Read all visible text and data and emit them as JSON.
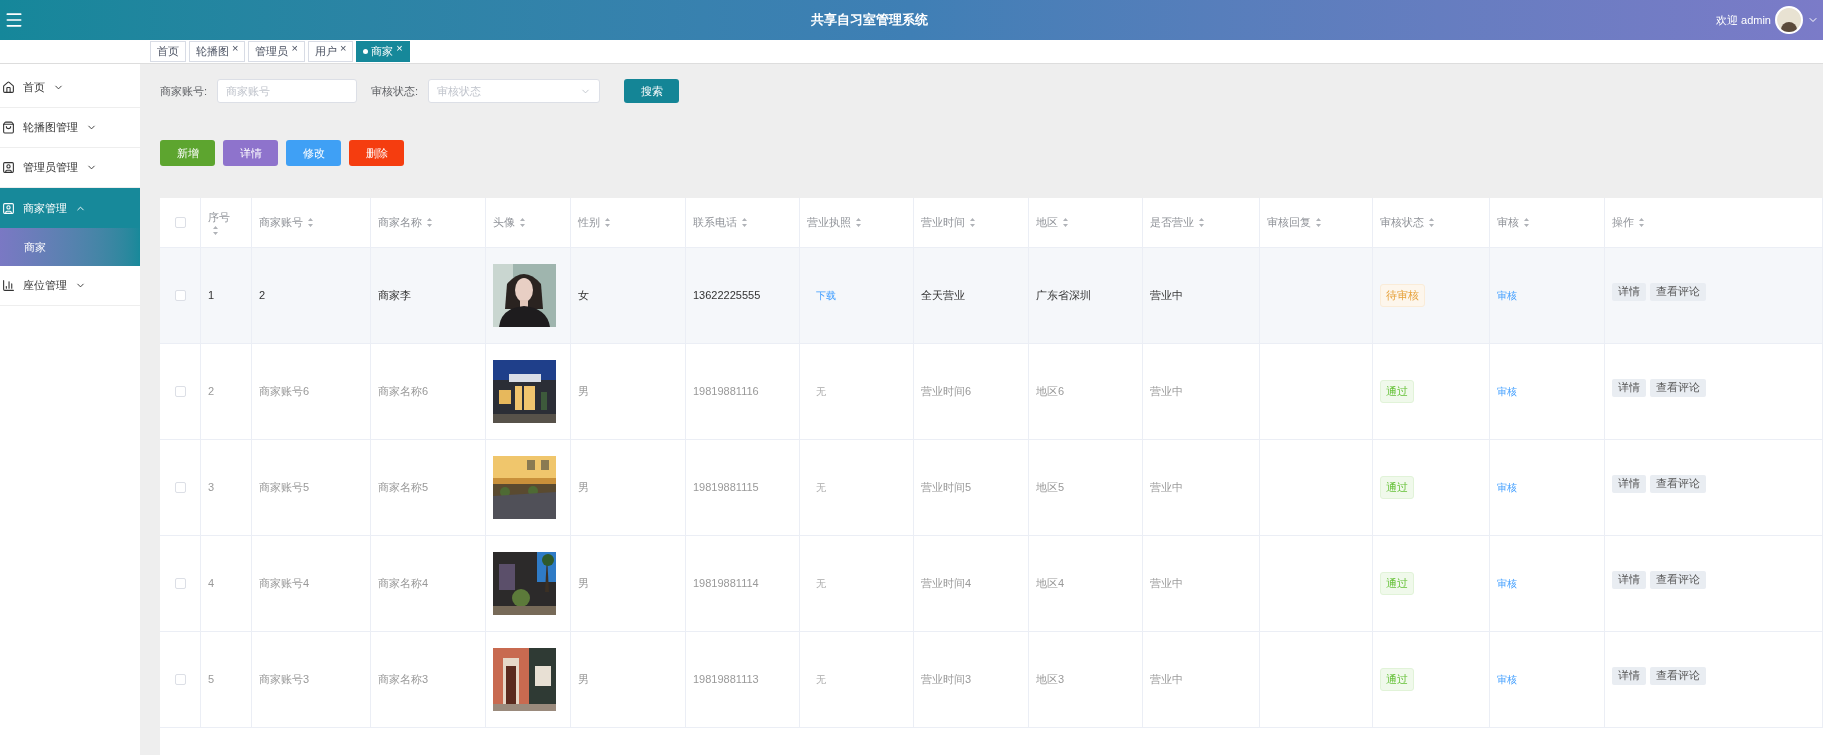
{
  "header": {
    "title": "共享自习室管理系统",
    "welcome": "欢迎 admin"
  },
  "tabs": [
    {
      "label": "首页",
      "selected": false
    },
    {
      "label": "轮播图",
      "close": "×",
      "selected": false
    },
    {
      "label": "管理员",
      "close": "×",
      "selected": false
    },
    {
      "label": "用户",
      "close": "×",
      "selected": false
    },
    {
      "label": "商家",
      "close": "×",
      "selected": true
    }
  ],
  "sidebar": {
    "items": [
      {
        "label": "首页",
        "expanded": false,
        "selected": false
      },
      {
        "label": "轮播图管理",
        "expanded": false,
        "selected": false
      },
      {
        "label": "管理员管理",
        "expanded": false,
        "selected": false
      },
      {
        "label": "商家管理",
        "expanded": true,
        "selected": true,
        "children": [
          {
            "label": "商家"
          }
        ]
      },
      {
        "label": "座位管理",
        "expanded": false,
        "selected": false
      }
    ]
  },
  "search": {
    "fields": [
      {
        "label": "商家账号:",
        "placeholder": "商家账号",
        "kind": "input"
      },
      {
        "label": "审核状态:",
        "placeholder": "审核状态",
        "kind": "select"
      }
    ],
    "button": "搜索"
  },
  "actions": [
    {
      "label": "新增",
      "color": "#5da52f"
    },
    {
      "label": "详情",
      "color": "#8e73cc"
    },
    {
      "label": "修改",
      "color": "#3fa0f5"
    },
    {
      "label": "删除",
      "color": "#f53d0f"
    }
  ],
  "table": {
    "select_all_checked": false,
    "columns": [
      {
        "label": "序号"
      },
      {
        "label": "商家账号"
      },
      {
        "label": "商家名称"
      },
      {
        "label": "头像"
      },
      {
        "label": "性别"
      },
      {
        "label": "联系电话"
      },
      {
        "label": "营业执照"
      },
      {
        "label": "营业时间"
      },
      {
        "label": "地区"
      },
      {
        "label": "是否营业"
      },
      {
        "label": "审核回复"
      },
      {
        "label": "审核状态"
      },
      {
        "label": "审核"
      },
      {
        "label": "操作"
      }
    ],
    "rows": [
      {
        "hovered": true,
        "checked": false,
        "index": "1",
        "account": "2",
        "name": "商家李",
        "gender": "女",
        "phone": "13622225555",
        "license": {
          "text": "下载",
          "kind": "link"
        },
        "hours": "全天营业",
        "region": "广东省深圳",
        "open": "营业中",
        "status": {
          "text": "待审核",
          "kind": "pending"
        },
        "review": "审核",
        "ops": [
          "详情",
          "查看评论"
        ]
      },
      {
        "hovered": false,
        "checked": false,
        "index": "2",
        "account": "商家账号6",
        "name": "商家名称6",
        "gender": "男",
        "phone": "19819881116",
        "license": {
          "text": "无",
          "kind": "text"
        },
        "hours": "营业时间6",
        "region": "地区6",
        "open": "营业中",
        "status": {
          "text": "通过",
          "kind": "approved"
        },
        "review": "审核",
        "ops": [
          "详情",
          "查看评论"
        ]
      },
      {
        "hovered": false,
        "checked": false,
        "index": "3",
        "account": "商家账号5",
        "name": "商家名称5",
        "gender": "男",
        "phone": "19819881115",
        "license": {
          "text": "无",
          "kind": "text"
        },
        "hours": "营业时间5",
        "region": "地区5",
        "open": "营业中",
        "status": {
          "text": "通过",
          "kind": "approved"
        },
        "review": "审核",
        "ops": [
          "详情",
          "查看评论"
        ]
      },
      {
        "hovered": false,
        "checked": false,
        "index": "4",
        "account": "商家账号4",
        "name": "商家名称4",
        "gender": "男",
        "phone": "19819881114",
        "license": {
          "text": "无",
          "kind": "text"
        },
        "hours": "营业时间4",
        "region": "地区4",
        "open": "营业中",
        "status": {
          "text": "通过",
          "kind": "approved"
        },
        "review": "审核",
        "ops": [
          "详情",
          "查看评论"
        ]
      },
      {
        "hovered": false,
        "checked": false,
        "index": "5",
        "account": "商家账号3",
        "name": "商家名称3",
        "gender": "男",
        "phone": "19819881113",
        "license": {
          "text": "无",
          "kind": "text"
        },
        "hours": "营业时间3",
        "region": "地区3",
        "open": "营业中",
        "status": {
          "text": "通过",
          "kind": "approved"
        },
        "review": "审核",
        "ops": [
          "详情",
          "查看评论"
        ]
      }
    ]
  }
}
